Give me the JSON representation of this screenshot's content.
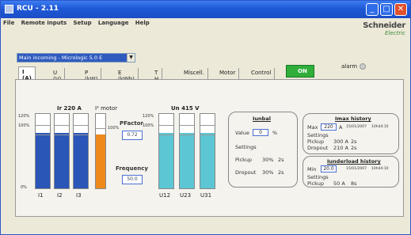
{
  "window": {
    "title": "RCU - 2.11"
  },
  "menu": [
    "File",
    "Remote inputs",
    "Setup",
    "Language",
    "Help"
  ],
  "logo": {
    "line1": "Schneider",
    "line2": "Electric"
  },
  "device_select": {
    "value": "Main incoming - Micrologic 5.0 E"
  },
  "alarm_label": "alarm",
  "tabs": [
    "I (A)",
    "U (V)",
    "P (kW)",
    "E (kWh)",
    "T H D",
    "Miscell.",
    "Motor",
    "Control"
  ],
  "on_button": "ON",
  "current": {
    "header": "Ir 220 A",
    "scale": [
      "120%",
      "100%",
      "0%"
    ],
    "labels": [
      "I1",
      "I2",
      "I3"
    ],
    "levels": [
      0.75,
      0.75,
      0.75
    ]
  },
  "thermal": {
    "header": "I² motor",
    "scale": "100%",
    "level": 0.72
  },
  "pfactor": {
    "label": "PFactor",
    "value": "0.72"
  },
  "frequency": {
    "label": "Frequency",
    "value": "50.0"
  },
  "voltage": {
    "header": "Un 415 V",
    "scale": [
      "120%",
      "100%"
    ],
    "labels": [
      "U12",
      "U23",
      "U31"
    ],
    "levels": [
      0.75,
      0.75,
      0.75
    ]
  },
  "ionbal": {
    "title": "Iunbal",
    "value_label": "Value",
    "value": "0",
    "unit": "%",
    "settings_label": "Settings",
    "pickup": {
      "label": "Pickup",
      "pct": "30%",
      "time": "2s"
    },
    "dropout": {
      "label": "Dropout",
      "pct": "30%",
      "time": "2s"
    }
  },
  "imax_history": {
    "title": "Imax history",
    "max_label": "Max",
    "max_value": "220",
    "unit": "A",
    "date": "15/01/2007",
    "time": "10h44:10",
    "settings_label": "Settings",
    "pickup": {
      "label": "Pickup",
      "value": "300 A",
      "time": "2s"
    },
    "dropout": {
      "label": "Dropout",
      "value": "210 A",
      "time": "2s"
    }
  },
  "underload_history": {
    "title": "Iunderload history",
    "min_label": "Min",
    "min_value": "20.0",
    "date": "15/01/2007",
    "time": "10h44:10",
    "settings_label": "Settings",
    "pickup": {
      "label": "Pickup",
      "value": "50 A",
      "time": "8s"
    }
  },
  "colors": {
    "current_bar": "#2a56b8",
    "thermal_bar": "#ee8a1c",
    "voltage_bar": "#5cc6d4"
  }
}
